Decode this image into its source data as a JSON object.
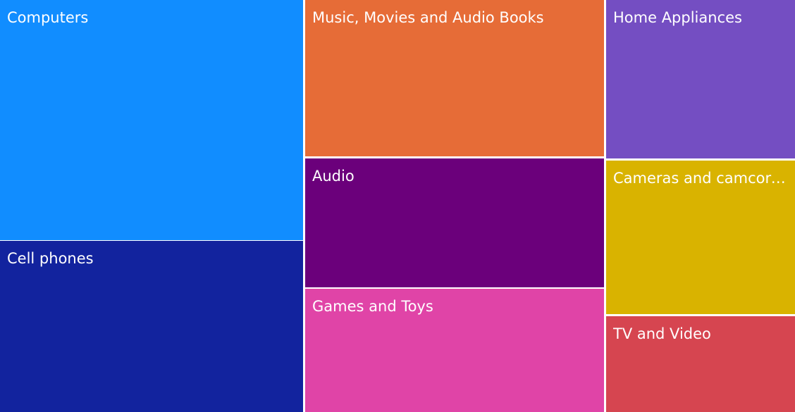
{
  "chart_data": {
    "type": "treemap",
    "title": "",
    "items": [
      {
        "label": "Computers",
        "color": "#118dff",
        "column": 0
      },
      {
        "label": "Cell phones",
        "color": "#12239e",
        "column": 0
      },
      {
        "label": "Music, Movies and Audio Books",
        "color": "#e66c37",
        "column": 1
      },
      {
        "label": "Audio",
        "color": "#6b007b",
        "column": 1
      },
      {
        "label": "Games and Toys",
        "color": "#e044a7",
        "column": 1
      },
      {
        "label": "Home Appliances",
        "color": "#744ec2",
        "column": 2
      },
      {
        "label": "Cameras and camcorders",
        "color": "#d9b300",
        "column": 2
      },
      {
        "label": "TV and Video",
        "color": "#d64550",
        "column": 2
      }
    ]
  }
}
